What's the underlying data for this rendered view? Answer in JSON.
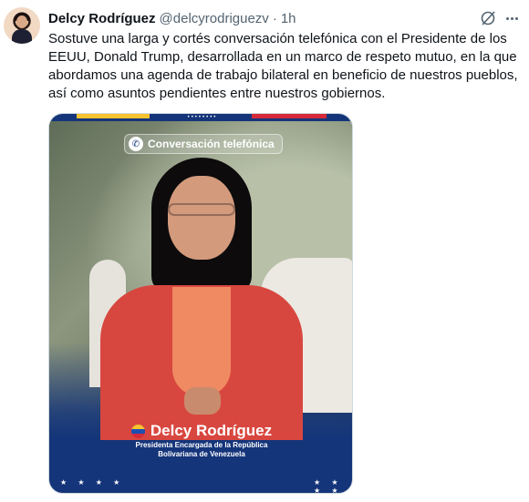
{
  "tweet": {
    "author_name": "Delcy Rodríguez",
    "author_handle": "@delcyrodriguezv",
    "separator": "·",
    "time": "1h",
    "text": "Sostuve una larga y cortés conversación telefónica con el Presidente de los EEUU, Donald Trump, desarrollada en un marco de respeto mutuo, en la que abordamos una agenda de trabajo bilateral en beneficio de nuestros pueblos, así como asuntos pendientes entre nuestros gobiernos."
  },
  "icons": {
    "grok": "grok-icon",
    "more": "more-icon",
    "phone": "phone-icon"
  },
  "media": {
    "badge": "Conversación telefónica",
    "name": "Delcy Rodríguez",
    "subtitle_line1": "Presidenta Encargada de la República",
    "subtitle_line2": "Bolivariana de Venezuela",
    "stars": "★ ★ ★ ★"
  },
  "colors": {
    "brand_blue": "#15357a",
    "flag_yellow": "#f6c32e",
    "flag_red": "#d62a3a",
    "text_secondary": "#536471"
  }
}
